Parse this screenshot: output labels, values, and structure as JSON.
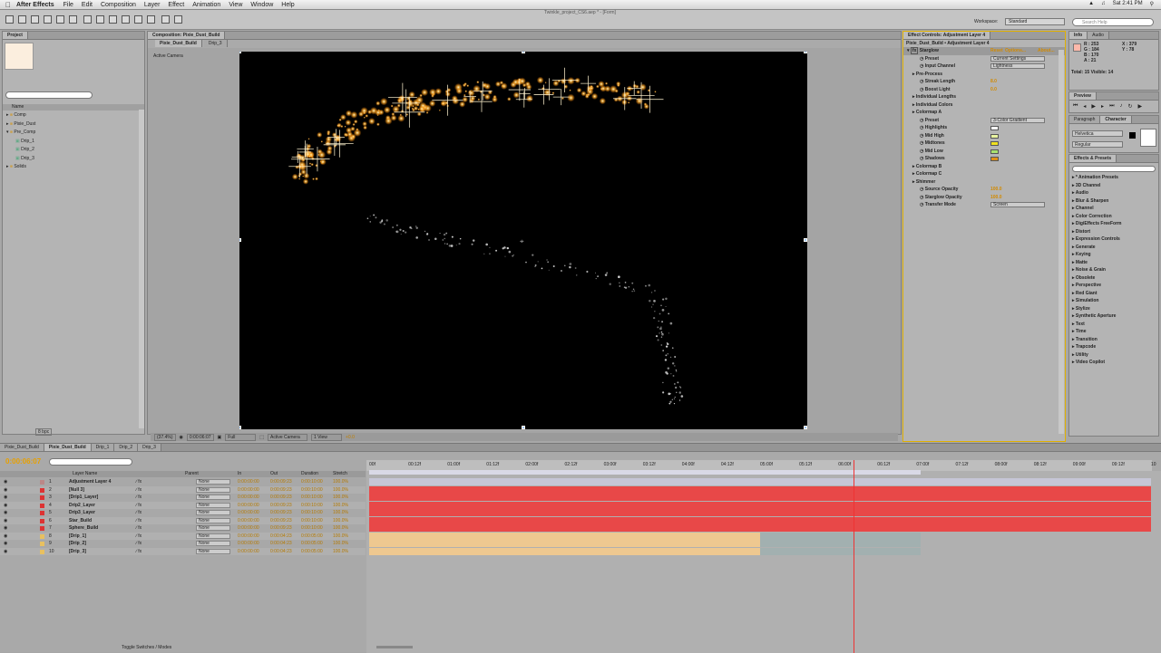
{
  "menubar": {
    "app_name": "After Effects",
    "items": [
      "File",
      "Edit",
      "Composition",
      "Layer",
      "Effect",
      "Animation",
      "View",
      "Window",
      "Help"
    ],
    "clock": "Sat 2:41 PM",
    "window_title": "Twinkle_project_CS6.aep * - [Form]"
  },
  "toolbar": {
    "workspace_label": "Workspace:",
    "workspace_value": "Standard",
    "search_placeholder": "Search Help"
  },
  "project": {
    "tab": "Project",
    "search_placeholder": "",
    "name_header": "Name",
    "items": [
      {
        "label": "Comp",
        "level": 0
      },
      {
        "label": "Pixie_Dust",
        "level": 0
      },
      {
        "label": "Pre_Comp",
        "level": 0
      },
      {
        "label": "Drip_1",
        "level": 1
      },
      {
        "label": "Drip_2",
        "level": 1
      },
      {
        "label": "Drip_3",
        "level": 1
      },
      {
        "label": "Solids",
        "level": 0
      }
    ],
    "bpc": "8 bpc"
  },
  "composition": {
    "panel_title": "Composition: Pixie_Dust_Build",
    "tabs": [
      "Pixie_Dust_Build",
      "Drip_3"
    ],
    "camera_label": "Active Camera",
    "zoom": "(37.4%)",
    "timecode": "0:00:06:07",
    "resolution": "Full",
    "camera_select": "Active Camera",
    "view_select": "1 View",
    "exposure": "+0.0"
  },
  "effect_controls": {
    "panel_title": "Effect Controls: Adjustment Layer 4",
    "breadcrumb": "Pixie_Dust_Build • Adjustment Layer 4",
    "effect_name": "Starglow",
    "effect_links": [
      "Reset",
      "Options...",
      "About..."
    ],
    "rows": [
      {
        "label": "Preset",
        "value": "Current Settings",
        "type": "select"
      },
      {
        "label": "Input Channel",
        "value": "Lightness",
        "type": "select"
      },
      {
        "label": "Pre-Process",
        "value": "",
        "type": "group"
      },
      {
        "label": "Streak Length",
        "value": "8.0",
        "type": "num"
      },
      {
        "label": "Boost Light",
        "value": "0.0",
        "type": "num"
      },
      {
        "label": "Individual Lengths",
        "value": "",
        "type": "group"
      },
      {
        "label": "Individual Colors",
        "value": "",
        "type": "group"
      },
      {
        "label": "Colormap A",
        "value": "",
        "type": "group"
      },
      {
        "label": "Preset",
        "value": "3-Color Gradient",
        "type": "select"
      },
      {
        "label": "Highlights",
        "value": "#ffffff",
        "type": "color"
      },
      {
        "label": "Mid High",
        "value": "#e8f3a0",
        "type": "color"
      },
      {
        "label": "Midtones",
        "value": "#f0e020",
        "type": "color"
      },
      {
        "label": "Mid Low",
        "value": "#a8e070",
        "type": "color"
      },
      {
        "label": "Shadows",
        "value": "#e09018",
        "type": "color"
      },
      {
        "label": "Colormap B",
        "value": "",
        "type": "group"
      },
      {
        "label": "Colormap C",
        "value": "",
        "type": "group"
      },
      {
        "label": "Shimmer",
        "value": "",
        "type": "group"
      },
      {
        "label": "Source Opacity",
        "value": "100.0",
        "type": "num"
      },
      {
        "label": "Starglow Opacity",
        "value": "100.0",
        "type": "num"
      },
      {
        "label": "Transfer Mode",
        "value": "Screen",
        "type": "select"
      }
    ]
  },
  "info": {
    "tabs": [
      "Info",
      "Audio"
    ],
    "r": "R : 253",
    "g": "G : 184",
    "b": "B : 170",
    "a": "A : 21",
    "x": "X : 379",
    "y": "Y : 78",
    "total": "Total: 15  Visible: 14"
  },
  "preview": {
    "tab": "Preview"
  },
  "character": {
    "tabs": [
      "Paragraph",
      "Character"
    ],
    "font": "Helvetica",
    "style": "Regular"
  },
  "effects_presets": {
    "tab": "Effects & Presets",
    "items": [
      "* Animation Presets",
      "3D Channel",
      "Audio",
      "Blur & Sharpen",
      "Channel",
      "Color Correction",
      "DigiEffects FreeForm",
      "Distort",
      "Expression Controls",
      "Generate",
      "Keying",
      "Matte",
      "Noise & Grain",
      "Obsolete",
      "Perspective",
      "Red Giant",
      "Simulation",
      "Stylize",
      "Synthetic Aperture",
      "Text",
      "Time",
      "Transition",
      "Trapcode",
      "Utility",
      "Video Copilot"
    ]
  },
  "timeline": {
    "tabs": [
      "Pixie_Dust_Build",
      "Pixie_Dust_Build",
      "Drip_1",
      "Drip_2",
      "Drip_3"
    ],
    "current_time": "0:00:06:07",
    "headers": {
      "name": "Layer Name",
      "parent": "Parent",
      "in": "In",
      "out": "Out",
      "duration": "Duration",
      "stretch": "Stretch"
    },
    "ruler": [
      "00f",
      "00:12f",
      "01:00f",
      "01:12f",
      "02:00f",
      "02:12f",
      "03:00f",
      "03:12f",
      "04:00f",
      "04:12f",
      "05:00f",
      "05:12f",
      "06:00f",
      "06:12f",
      "07:00f",
      "07:12f",
      "08:00f",
      "08:12f",
      "09:00f",
      "09:12f",
      "10"
    ],
    "layers": [
      {
        "num": "1",
        "name": "Adjustment Layer 4",
        "color": "#b88",
        "in": "0:00:00:00",
        "out": "0:00:09:23",
        "dur": "0:00:10:00",
        "str": "100.0%",
        "parent": "None",
        "bar": "#c6c6d6",
        "bar_end": 1.0
      },
      {
        "num": "2",
        "name": "[Null 3]",
        "color": "#d33",
        "in": "0:00:00:00",
        "out": "0:00:09:23",
        "dur": "0:00:10:00",
        "str": "100.0%",
        "parent": "None",
        "bar": "#e84848",
        "bar_end": 1.0
      },
      {
        "num": "3",
        "name": "[Drip1_Layer]",
        "color": "#d33",
        "in": "0:00:00:00",
        "out": "0:00:09:23",
        "dur": "0:00:10:00",
        "str": "100.0%",
        "parent": "None",
        "bar": "#e84848",
        "bar_end": 1.0
      },
      {
        "num": "4",
        "name": "Drip2_Layer",
        "color": "#d33",
        "in": "0:00:00:00",
        "out": "0:00:09:23",
        "dur": "0:00:10:00",
        "str": "100.0%",
        "parent": "None",
        "bar": "#e84848",
        "bar_end": 1.0
      },
      {
        "num": "5",
        "name": "Drip3_Layer",
        "color": "#d33",
        "in": "0:00:00:00",
        "out": "0:00:09:23",
        "dur": "0:00:10:00",
        "str": "100.0%",
        "parent": "None",
        "bar": "#e84848",
        "bar_end": 1.0
      },
      {
        "num": "6",
        "name": "Star_Build",
        "color": "#d33",
        "in": "0:00:00:00",
        "out": "0:00:09:23",
        "dur": "0:00:10:00",
        "str": "100.0%",
        "parent": "None",
        "bar": "#e84848",
        "bar_end": 1.0
      },
      {
        "num": "7",
        "name": "Sphere_Build",
        "color": "#d33",
        "in": "0:00:00:00",
        "out": "0:00:09:23",
        "dur": "0:00:10:00",
        "str": "100.0%",
        "parent": "None",
        "bar": "#e84848",
        "bar_end": 1.0
      },
      {
        "num": "8",
        "name": "[Drip_1]",
        "color": "#e8c060",
        "in": "0:00:00:00",
        "out": "0:00:04:23",
        "dur": "0:00:05:00",
        "str": "100.0%",
        "parent": "None",
        "bar": "#eec890",
        "bar_end": 0.5
      },
      {
        "num": "9",
        "name": "[Drip_2]",
        "color": "#e8c060",
        "in": "0:00:00:00",
        "out": "0:00:04:23",
        "dur": "0:00:05:00",
        "str": "100.0%",
        "parent": "None",
        "bar": "#eec890",
        "bar_end": 0.5
      },
      {
        "num": "10",
        "name": "[Drip_3]",
        "color": "#e8c060",
        "in": "0:00:00:00",
        "out": "0:00:04:23",
        "dur": "0:00:05:00",
        "str": "100.0%",
        "parent": "None",
        "bar": "#eec890",
        "bar_end": 0.5
      }
    ],
    "playhead_fraction": 0.62,
    "work_area_end_fraction": 0.705,
    "toggle_label": "Toggle Switches / Modes"
  }
}
